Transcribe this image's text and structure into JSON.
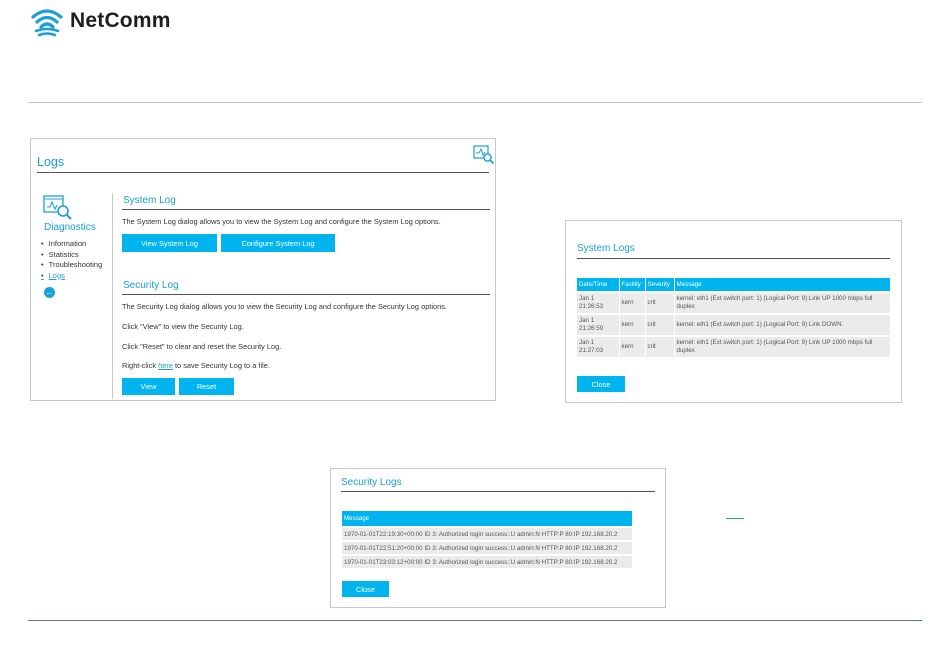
{
  "brand": {
    "name": "NetComm"
  },
  "logs_panel": {
    "title": "Logs",
    "sidebar": {
      "title": "Diagnostics",
      "items": [
        "Information",
        "Statistics",
        "Troubleshooting",
        "Logs"
      ]
    },
    "system_log": {
      "title": "System Log",
      "description": "The System Log dialog allows you to view the System Log and configure the System Log options.",
      "view_button": "View System Log",
      "configure_button": "Configure System Log"
    },
    "security_log": {
      "title": "Security Log",
      "description": "The Security Log dialog allows you to view the Security Log and configure the Security Log options.",
      "view_hint": "Click \"View\" to view the Security Log.",
      "reset_hint": "Click \"Reset\" to clear and reset the Security Log.",
      "save_hint_prefix": "Right-click ",
      "save_hint_link": "here",
      "save_hint_suffix": " to save Security Log to a file.",
      "view_button": "View",
      "reset_button": "Reset"
    }
  },
  "system_logs_dialog": {
    "title": "System Logs",
    "columns": [
      "Date/Time",
      "Facility",
      "Severity",
      "Message"
    ],
    "rows": [
      {
        "date": "Jan 1",
        "time": "21:26:53",
        "facility": "kern",
        "severity": "crit",
        "message": "kernel: eth1 (Ext switch port: 1) (Logical Port: 9) Link UP 1000 mbps full duplex"
      },
      {
        "date": "Jan 1",
        "time": "21:26:59",
        "facility": "kern",
        "severity": "crit",
        "message": "kernel: eth1 (Ext switch port: 1) (Logical Port: 9) Link DOWN."
      },
      {
        "date": "Jan 1",
        "time": "21:27:03",
        "facility": "kern",
        "severity": "crit",
        "message": "kernel: eth1 (Ext switch port: 1) (Logical Port: 9) Link UP 1000 mbps full duplex"
      }
    ],
    "close_button": "Close"
  },
  "security_logs_dialog": {
    "title": "Security Logs",
    "column": "Message",
    "rows": [
      "1970-01-01T22:19:30+00:00 ID 3: Authorized login success::U admin:N HTTP:P 80:IP 192.168.20.2",
      "1970-01-01T22:51:20+00:00 ID 3: Authorized login success::U admin:N HTTP:P 80:IP 192.168.20.2",
      "1970-01-01T23:03:12+00:00 ID 3: Authorized login success::U admin:N HTTP:P 80:IP 192.168.20.2"
    ],
    "close_button": "Close"
  },
  "colors": {
    "accent": "#00b4f0",
    "title": "#1aa0d6",
    "row_bg": "#ebebeb"
  }
}
